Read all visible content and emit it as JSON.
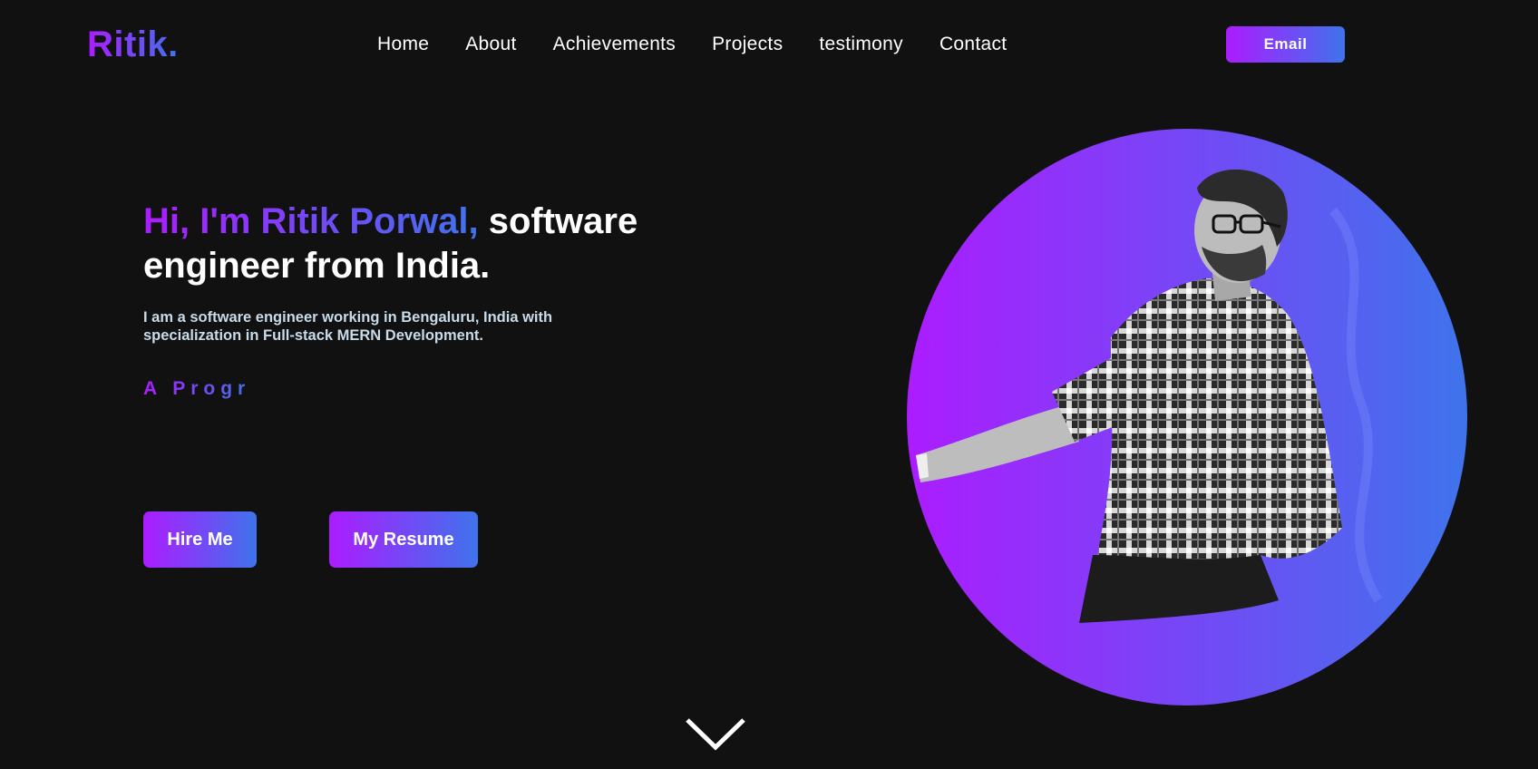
{
  "header": {
    "logo": "Ritik.",
    "nav": [
      "Home",
      "About",
      "Achievements",
      "Projects",
      "testimony",
      "Contact"
    ],
    "email_label": "Email"
  },
  "hero": {
    "title_highlight": "Hi, I'm Ritik Porwal,",
    "title_plain": "software engineer from India.",
    "description": "I am a software engineer working in Bengaluru, India with specialization in Full-stack MERN Development.",
    "typing_text": "A Progr",
    "hire_label": "Hire Me",
    "resume_label": "My Resume"
  },
  "icons": {
    "scroll": "chevron-down-icon",
    "portrait": "profile-photo"
  },
  "colors": {
    "background": "#121111",
    "accent_start": "#ac1cff",
    "accent_end": "#3f73ec",
    "description_text": "#c7dbe8"
  }
}
